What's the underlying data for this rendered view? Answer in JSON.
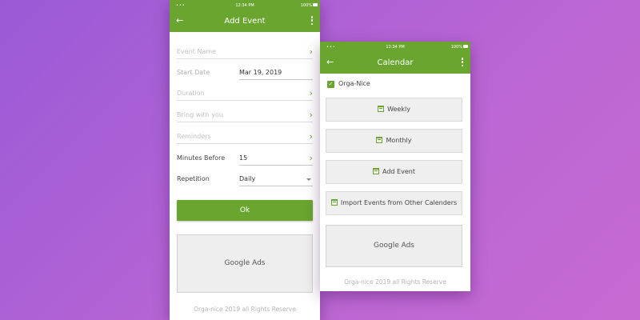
{
  "colors": {
    "accent": "#6aa52f",
    "background_start": "#9a5ad6",
    "background_end": "#c76ad2"
  },
  "status_bar": {
    "signal": "•••",
    "time": "12:34 PM",
    "battery": "100%"
  },
  "add_event": {
    "title": "Add Event",
    "back_icon": "arrow-left-icon",
    "menu_icon": "more-vertical-icon",
    "fields": {
      "event_name": {
        "placeholder": "Event Name"
      },
      "start_date": {
        "label": "Start Date",
        "value": "Mar 19, 2019"
      },
      "duration": {
        "placeholder": "Duration"
      },
      "bring_with_you": {
        "placeholder": "Bring with you"
      },
      "reminders": {
        "placeholder": "Reminders"
      },
      "minutes_before": {
        "label": "Minutes Before",
        "value": "15"
      },
      "repetition": {
        "label": "Repetition",
        "value": "Daily"
      }
    },
    "ok_label": "Ok",
    "ads_label": "Google Ads",
    "footer": "Orga-nice 2019 all Rights Reserve"
  },
  "calendar": {
    "title": "Calendar",
    "back_icon": "arrow-left-icon",
    "menu_icon": "more-vertical-icon",
    "checkbox_label": "Orga-Nice",
    "checkbox_checked": true,
    "buttons": [
      {
        "label": "Weekly",
        "icon": "calendar-icon"
      },
      {
        "label": "Monthly",
        "icon": "calendar-icon"
      },
      {
        "label": "Add Event",
        "icon": "calendar-icon"
      },
      {
        "label": "Import Events from Other Calenders",
        "icon": "calendar-icon"
      }
    ],
    "ads_label": "Google Ads",
    "footer": "Orga-nice 2019 all Rights Reserve"
  }
}
